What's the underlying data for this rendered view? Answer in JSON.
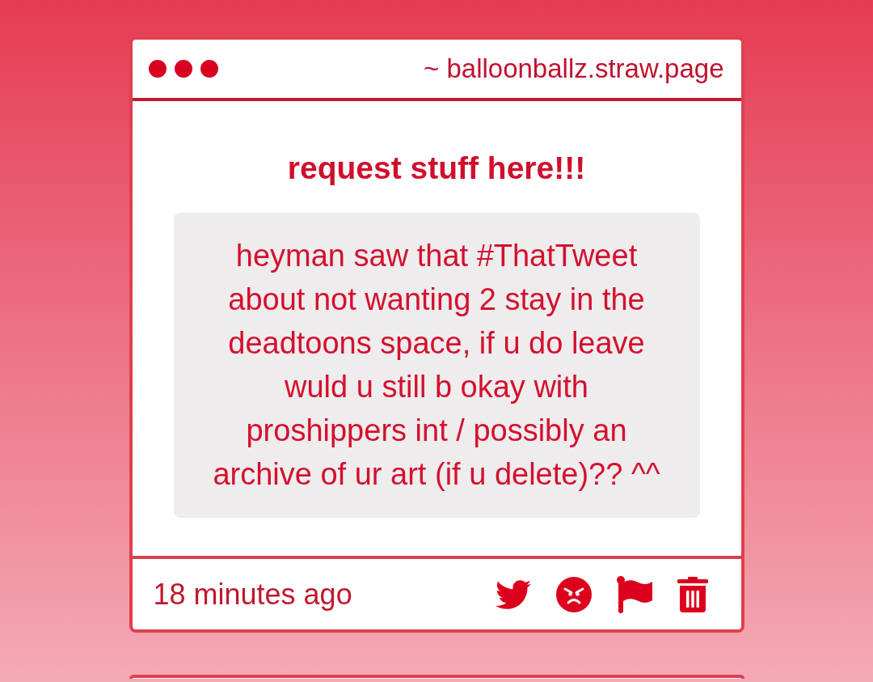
{
  "header": {
    "url": "~ balloonballz.straw.page"
  },
  "post": {
    "title": "request stuff here!!!",
    "message": "heyman saw that #ThatTweet about not wanting 2 stay in the deadtoons space, if u do leave wuld u still b okay with proshippers int / possibly an archive of ur art (if u delete)?? ^^"
  },
  "footer": {
    "time": "18 minutes ago",
    "actions": [
      {
        "kind": "tweet"
      },
      {
        "kind": "react"
      },
      {
        "kind": "report"
      },
      {
        "kind": "delete"
      }
    ]
  }
}
